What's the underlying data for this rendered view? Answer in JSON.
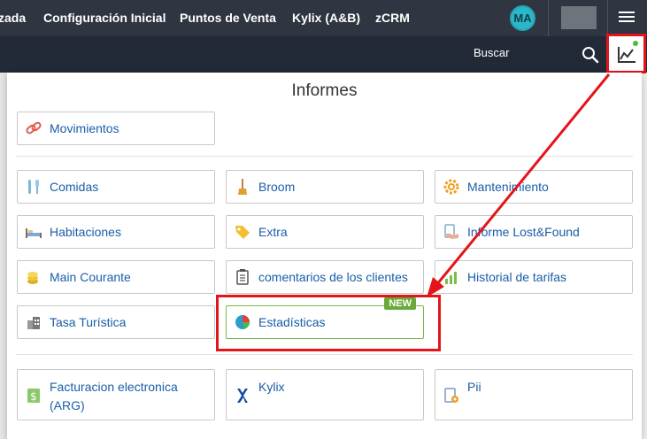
{
  "topnav": {
    "items": [
      "zada",
      "Configuración Inicial",
      "Puntos de Venta",
      "Kylix (A&B)",
      "zCRM"
    ],
    "avatar": "MA"
  },
  "subbar": {
    "search_label": "Buscar"
  },
  "panel": {
    "title": "Informes",
    "cards": {
      "movimientos": "Movimientos",
      "comidas": "Comidas",
      "broom": "Broom",
      "mantenimiento": "Mantenimiento",
      "habitaciones": "Habitaciones",
      "extra": "Extra",
      "lostfound": "Informe Lost&Found",
      "maincourante": "Main Courante",
      "comentarios": "comentarios de los clientes",
      "tarifas": "Historial de tarifas",
      "tasa": "Tasa Turística",
      "estadisticas": "Estadísticas",
      "facturacion": "Facturacion electronica (ARG)",
      "kylix": "Kylix",
      "pii": "Pii"
    },
    "new_badge": "NEW"
  },
  "colors": {
    "accent": "#1a5ea8",
    "highlight": "#e4141b",
    "new": "#6aaa3b",
    "topnav": "#2f3641"
  }
}
